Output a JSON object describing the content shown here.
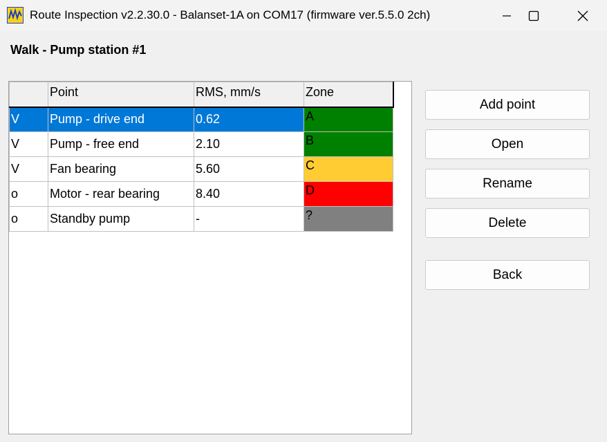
{
  "window": {
    "title": "Route Inspection v2.2.30.0 - Balanset-1A on COM17 (firmware ver.5.5.0 2ch)",
    "icon": "vibration-logo-icon"
  },
  "walk_title": "Walk - Pump station #1",
  "table": {
    "columns": [
      "",
      "Point",
      "RMS, mm/s",
      "Zone"
    ],
    "rows": [
      {
        "status": "V",
        "point": "Pump - drive end",
        "rms": "0.62",
        "zone": "A",
        "zone_color": "#008000",
        "selected": true
      },
      {
        "status": "V",
        "point": "Pump - free end",
        "rms": "2.10",
        "zone": "B",
        "zone_color": "#008000",
        "selected": false
      },
      {
        "status": "V",
        "point": "Fan bearing",
        "rms": "5.60",
        "zone": "C",
        "zone_color": "#ffcc33",
        "selected": false
      },
      {
        "status": "o",
        "point": "Motor - rear bearing",
        "rms": "8.40",
        "zone": "D",
        "zone_color": "#ff0000",
        "selected": false
      },
      {
        "status": "o",
        "point": "Standby pump",
        "rms": "-",
        "zone": "?",
        "zone_color": "#808080",
        "selected": false
      }
    ]
  },
  "buttons": {
    "add_point": "Add point",
    "open": "Open",
    "rename": "Rename",
    "delete": "Delete",
    "back": "Back"
  },
  "colors": {
    "selection": "#0078d7",
    "window_bg": "#f0f0f0"
  }
}
